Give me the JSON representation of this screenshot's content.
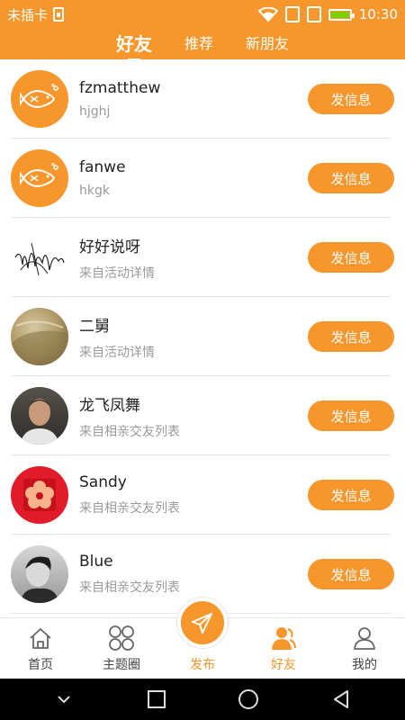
{
  "status": {
    "carrier": "未插卡",
    "time": "10:30"
  },
  "header": {
    "tabs": [
      {
        "label": "好友",
        "active": true
      },
      {
        "label": "推荐",
        "active": false
      },
      {
        "label": "新朋友",
        "active": false
      }
    ]
  },
  "friends": [
    {
      "name": "fzmatthew",
      "sub": "hjghj",
      "avatar": "fish-logo",
      "button": "发信息"
    },
    {
      "name": "fanwe",
      "sub": "hkgk",
      "avatar": "fish-logo",
      "button": "发信息"
    },
    {
      "name": "好好说呀",
      "sub": "来自活动详情",
      "avatar": "signature",
      "button": "发信息"
    },
    {
      "name": "二舅",
      "sub": "来自活动详情",
      "avatar": "gold-photo",
      "button": "发信息"
    },
    {
      "name": "龙飞凤舞",
      "sub": "来自相亲交友列表",
      "avatar": "man-photo",
      "button": "发信息"
    },
    {
      "name": "Sandy",
      "sub": "来自相亲交友列表",
      "avatar": "red-flower",
      "button": "发信息"
    },
    {
      "name": "Blue",
      "sub": "来自相亲交友列表",
      "avatar": "bw-photo",
      "button": "发信息"
    }
  ],
  "bottom_nav": {
    "items": [
      {
        "label": "首页",
        "icon": "home-icon",
        "active": false
      },
      {
        "label": "主题圈",
        "icon": "grid-circles-icon",
        "active": false
      },
      {
        "label": "发布",
        "icon": "paper-plane-icon",
        "active": false
      },
      {
        "label": "好友",
        "icon": "friends-icon",
        "active": true
      },
      {
        "label": "我的",
        "icon": "person-icon",
        "active": false
      }
    ]
  },
  "colors": {
    "accent": "#f6962b",
    "text": "#222222",
    "subtext": "#9a9a9a"
  }
}
